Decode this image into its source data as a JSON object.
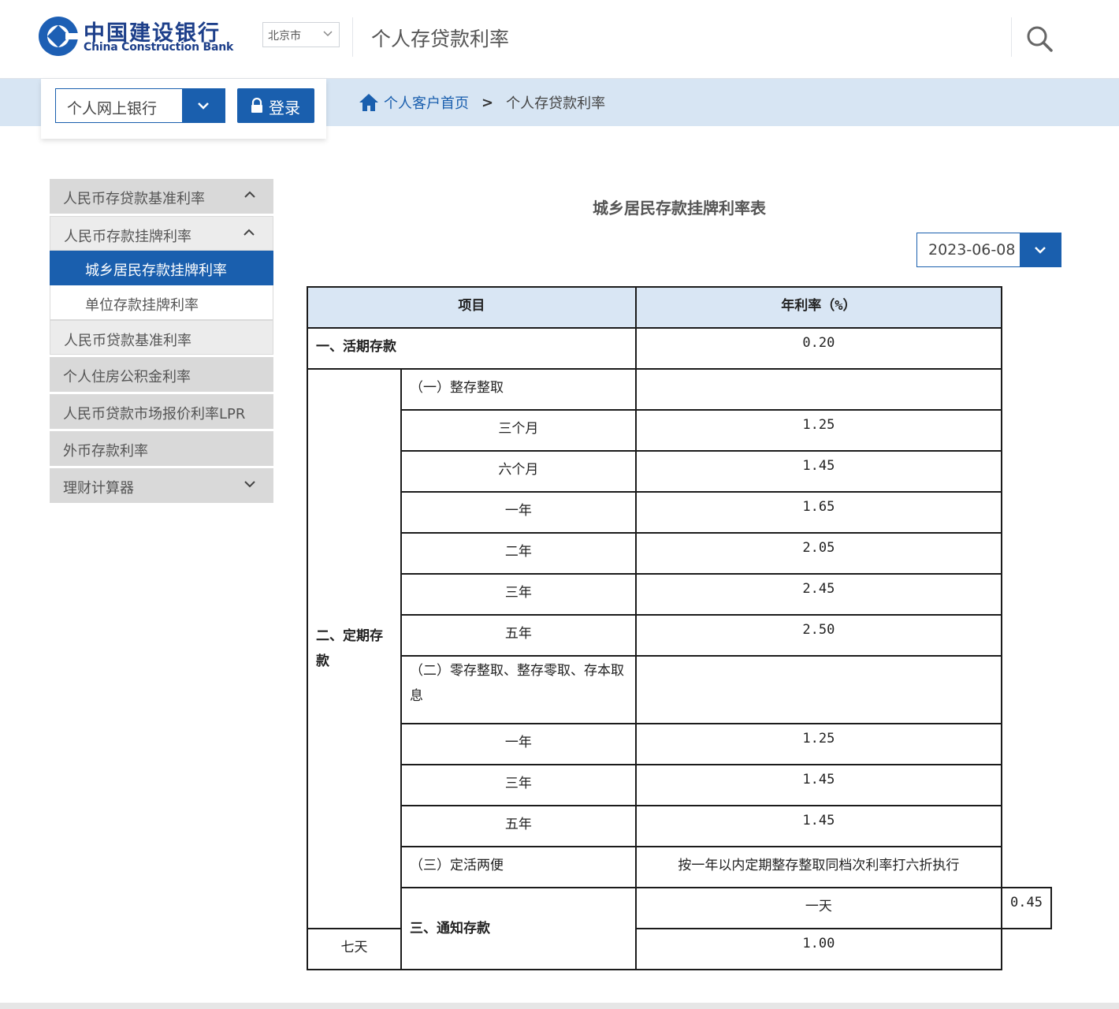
{
  "header": {
    "logo_cn": "中国建设银行",
    "logo_en": "China Construction Bank",
    "city": "北京市",
    "page_heading": "个人存贷款利率",
    "brand_color": "#1d3f8a"
  },
  "subbar": {
    "bank_select": "个人网上银行",
    "login_label": "登录",
    "breadcrumb": {
      "home": "个人客户首页",
      "separator": ">",
      "current": "个人存贷款利率"
    }
  },
  "sidebar": {
    "items": [
      {
        "label": "人民币存贷款基准利率"
      },
      {
        "label": "人民币存款挂牌利率"
      },
      {
        "label": "城乡居民存款挂牌利率"
      },
      {
        "label": "单位存款挂牌利率"
      },
      {
        "label": "人民币贷款基准利率"
      },
      {
        "label": "个人住房公积金利率"
      },
      {
        "label": "人民币贷款市场报价利率LPR"
      },
      {
        "label": "外币存款利率"
      },
      {
        "label": "理财计算器"
      }
    ]
  },
  "main": {
    "title": "城乡居民存款挂牌利率表",
    "date": "2023-06-08",
    "table": {
      "col_item": "项目",
      "col_rate": "年利率（%）",
      "demand": {
        "label": "一、活期存款",
        "rate": "0.20"
      },
      "fixed": {
        "label": "二、定期存款",
        "lump": {
          "label": "（一）整存整取",
          "rows": [
            {
              "term": "三个月",
              "rate": "1.25"
            },
            {
              "term": "六个月",
              "rate": "1.45"
            },
            {
              "term": "一年",
              "rate": "1.65"
            },
            {
              "term": "二年",
              "rate": "2.05"
            },
            {
              "term": "三年",
              "rate": "2.45"
            },
            {
              "term": "五年",
              "rate": "2.50"
            }
          ]
        },
        "install": {
          "label": "（二）零存整取、整存零取、存本取息",
          "rows": [
            {
              "term": "一年",
              "rate": "1.25"
            },
            {
              "term": "三年",
              "rate": "1.45"
            },
            {
              "term": "五年",
              "rate": "1.45"
            }
          ]
        },
        "flex": {
          "label": "（三）定活两便",
          "note": "按一年以内定期整存整取同档次利率打六折执行"
        }
      },
      "notice": {
        "label": "三、通知存款",
        "rows": [
          {
            "term": "一天",
            "rate": "0.45"
          },
          {
            "term": "七天",
            "rate": "1.00"
          }
        ]
      }
    }
  },
  "colors": {
    "accent": "#1a5fae",
    "subbar_bg": "#d7e5f3",
    "table_header_bg": "#d9e6f4"
  }
}
